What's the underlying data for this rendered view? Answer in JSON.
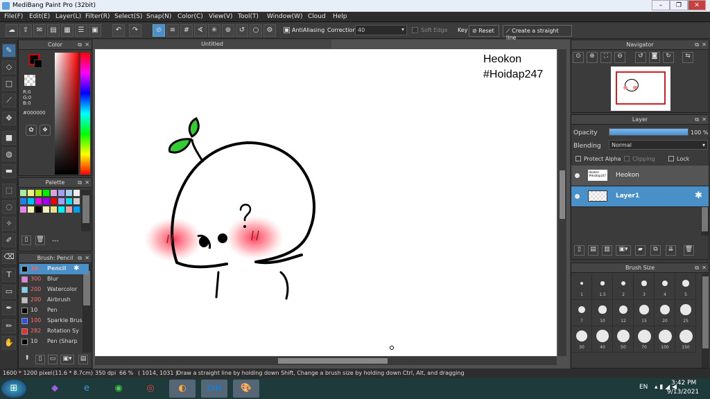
{
  "app": {
    "title": "MediBang Paint Pro (32bit)"
  },
  "menu": [
    "File(F)",
    "Edit(E)",
    "Layer(L)",
    "Filter(R)",
    "Select(S)",
    "Snap(N)",
    "Color(C)",
    "View(V)",
    "Tool(T)",
    "Window(W)",
    "Cloud",
    "Help"
  ],
  "toolbar": {
    "antialias_label": "AntiAliasing",
    "correction_label": "Correction",
    "correction_value": "40",
    "soft_edge_label": "Soft Edge",
    "key_label": "Key",
    "reset_label": "Reset",
    "straight_line_label": "Create a straight line"
  },
  "color_panel": {
    "title": "Color",
    "r": "R:0",
    "g": "G:0",
    "b": "B:0",
    "hex": "#000000"
  },
  "palette_panel": {
    "title": "Palette",
    "footer": "---"
  },
  "brush_panel": {
    "title": "Brush: Pencil",
    "items": [
      {
        "size": "10",
        "name": "Pencil",
        "color": "#000000"
      },
      {
        "size": "300",
        "name": "Blur",
        "color": "#e080e0"
      },
      {
        "size": "200",
        "name": "Watercolor",
        "color": "#80d0f0"
      },
      {
        "size": "200",
        "name": "Airbrush",
        "color": "#c0c0c0"
      },
      {
        "size": "10",
        "name": "Pen",
        "color": "#000000"
      },
      {
        "size": "100",
        "name": "Sparkle Brus",
        "color": "#3050e0"
      },
      {
        "size": "282",
        "name": "Rotation Sy",
        "color": "#e03030"
      },
      {
        "size": "10",
        "name": "Pen (Sharp",
        "color": "#000000"
      }
    ]
  },
  "document": {
    "tab_title": "Untitled",
    "text_line1": "Heokon",
    "text_line2": "#Hoidap247"
  },
  "navigator": {
    "title": "Navigator"
  },
  "layer_panel": {
    "title": "Layer",
    "opacity_label": "Opacity",
    "opacity_value": "100 %",
    "opacity_fraction": 1.0,
    "blending_label": "Blending",
    "blending_value": "Normal",
    "protect_alpha_label": "Protect Alpha",
    "clipping_label": "Clipping",
    "lock_label": "Lock",
    "layers": [
      {
        "name": "Heokon",
        "thumb_text": "Heokon #Hoidap247",
        "selected": false
      },
      {
        "name": "Layer1",
        "selected": true
      }
    ]
  },
  "brush_size_panel": {
    "title": "Brush Size",
    "sizes": [
      "1",
      "1.5",
      "2",
      "3",
      "4",
      "5",
      "7",
      "10",
      "12",
      "15",
      "20",
      "25",
      "30",
      "40",
      "50",
      "70",
      "100",
      "150"
    ]
  },
  "status": {
    "canvas_size": "1600 * 1200 pixel",
    "physical_size": "(11.6 * 8.7cm)",
    "dpi": "350 dpi",
    "zoom": "66 %",
    "coords": "( 1014, 1031 )",
    "hint": "Draw a straight line by holding down Shift, Change a brush size by holding down Ctrl, Alt, and dragging"
  },
  "taskbar": {
    "lang": "EN",
    "time": "3:42 PM",
    "date": "9/13/2021"
  },
  "colors": {
    "accent": "#4a8ecb",
    "selected_layer": "#4a90c8",
    "blush": "#ff4060",
    "leaf": "#33cc33"
  }
}
